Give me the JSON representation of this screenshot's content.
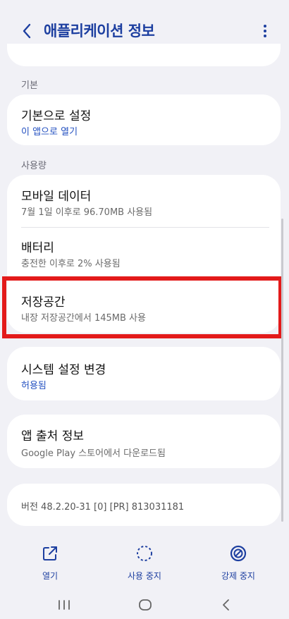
{
  "header": {
    "title": "애플리케이션 정보"
  },
  "sections": {
    "basic": {
      "label": "기본",
      "default_settings": {
        "title": "기본으로 설정",
        "sub": "이 앱으로 열기"
      }
    },
    "usage": {
      "label": "사용량",
      "mobile_data": {
        "title": "모바일 데이터",
        "sub": "7월 1일 이후로 96.70MB 사용됨"
      },
      "battery": {
        "title": "배터리",
        "sub": "충전한 이후로 2% 사용됨"
      },
      "storage": {
        "title": "저장공간",
        "sub": "내장 저장공간에서 145MB 사용"
      }
    },
    "system_settings": {
      "title": "시스템 설정 변경",
      "sub": "허용됨"
    },
    "app_source": {
      "title": "앱 출처 정보",
      "sub": "Google Play 스토어에서 다운로드됨"
    },
    "version": {
      "text": "버전 48.2.20-31 [0] [PR] 813031181"
    }
  },
  "actions": [
    {
      "label": "열기",
      "icon": "open-external-icon"
    },
    {
      "label": "사용 중지",
      "icon": "disable-icon"
    },
    {
      "label": "강제 중지",
      "icon": "force-stop-icon"
    }
  ],
  "colors": {
    "accent": "#1d3fa0",
    "link_blue": "#2350c0",
    "highlight_red": "#e31a1a",
    "background": "#f1f1f6"
  }
}
